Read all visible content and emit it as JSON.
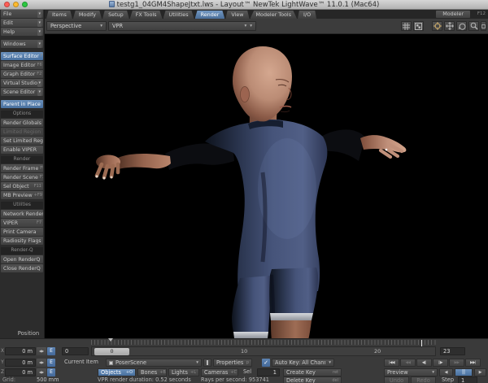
{
  "colors": {
    "accent_blue": "#4a6e99",
    "titlebar_close": "#ff5e57",
    "titlebar_minimize": "#febb2e",
    "titlebar_zoom": "#2bc840",
    "viewport_bg": "#000000",
    "panel_bg": "#3a3a3a",
    "suit_navy": "#46547a",
    "skin": "#b9856c"
  },
  "titlebar": {
    "title": "testg1_04GM4ShapeJtxt.lws - Layout™ NewTek LightWave™ 11.0.1 (Mac64)"
  },
  "icons": {
    "dropdown": "▾",
    "stepper": "◀▶",
    "checkmark": "✓"
  },
  "tabs": {
    "list": [
      {
        "label": "Items"
      },
      {
        "label": "Modify"
      },
      {
        "label": "Setup"
      },
      {
        "label": "FX Tools"
      },
      {
        "label": "Utilities"
      },
      {
        "label": "Render",
        "active": true
      },
      {
        "label": "View"
      },
      {
        "label": "Modeler Tools"
      },
      {
        "label": "I/O"
      }
    ],
    "modeler": {
      "label": "Modeler",
      "shortcut": "F12"
    }
  },
  "viewport": {
    "view_mode": "Perspective",
    "render_mode": "VPR",
    "content": "3d-human-figure-t-pose"
  },
  "sidebar": {
    "items": [
      {
        "label": "File",
        "type": "dropdown"
      },
      {
        "label": "Edit",
        "type": "dropdown"
      },
      {
        "label": "Help",
        "type": "dropdown"
      },
      {
        "label": "Windows",
        "type": "dropdown"
      },
      {
        "label": "Surface Editor",
        "shortcut": "F5",
        "active": true
      },
      {
        "label": "Image Editor",
        "shortcut": "F6"
      },
      {
        "label": "Graph Editor",
        "shortcut": "F2"
      },
      {
        "label": "Virtual Studio",
        "type": "dropdown"
      },
      {
        "label": "Scene Editor",
        "type": "dropdown"
      },
      {
        "label": "Parent in Place",
        "active": true
      },
      {
        "label": "Options",
        "type": "header"
      },
      {
        "label": "Render Globals",
        "shortcut": "F8"
      },
      {
        "label": "Limited Region",
        "disabled": true
      },
      {
        "label": "Set Limited Reg..."
      },
      {
        "label": "Enable VIPER"
      },
      {
        "label": "Render",
        "type": "header"
      },
      {
        "label": "Render Frame",
        "shortcut": "F9"
      },
      {
        "label": "Render Scene",
        "shortcut": "F10"
      },
      {
        "label": "Sel Object",
        "shortcut": "F11"
      },
      {
        "label": "MB Preview",
        "shortcut": "+F9"
      },
      {
        "label": "Utilities",
        "type": "header"
      },
      {
        "label": "Network Render"
      },
      {
        "label": "VIPER",
        "shortcut": "F7"
      },
      {
        "label": "Print Camera"
      },
      {
        "label": "Radiosity Flags"
      },
      {
        "label": "Render-Q",
        "type": "header"
      },
      {
        "label": "Open RenderQ"
      },
      {
        "label": "Close RenderQ"
      }
    ]
  },
  "position_panel": {
    "title": "Position",
    "axes": [
      {
        "axis": "X",
        "value": "0 m"
      },
      {
        "axis": "Y",
        "value": "0 m"
      },
      {
        "axis": "Z",
        "value": "0 m"
      }
    ],
    "envelope": "E",
    "grid_label": "Grid:",
    "grid_value": "500 mm"
  },
  "timeline": {
    "current_frame": "0",
    "handle": "0",
    "tick_10": "10",
    "tick_20": "20",
    "end_frame": "23"
  },
  "controls": {
    "current_item_label": "Current Item",
    "current_item_value": "PoserScene",
    "properties": "Properties",
    "properties_shortcut": "p",
    "autokey": "Auto Key: All Chann...",
    "types": [
      {
        "label": "Objects",
        "shortcut": "+O",
        "active": true
      },
      {
        "label": "Bones",
        "shortcut": "+B"
      },
      {
        "label": "Lights",
        "shortcut": "+L"
      },
      {
        "label": "Cameras",
        "shortcut": "+C"
      }
    ],
    "sel_label": "Sel",
    "sel_value": "1",
    "create_key": "Create Key",
    "create_key_shortcut": "ret",
    "delete_key": "Delete Key",
    "delete_key_shortcut": "del",
    "preview": "Preview",
    "undo": "Undo",
    "redo": "Redo",
    "step_label": "Step",
    "step_value": "1",
    "transport": [
      {
        "glyph": "|◀◀"
      },
      {
        "glyph": "◀◀",
        "disabled": true
      },
      {
        "glyph": "◀||"
      },
      {
        "glyph": "||▶"
      },
      {
        "glyph": "▶▶",
        "disabled": true
      },
      {
        "glyph": "▶▶|"
      }
    ],
    "play": [
      {
        "glyph": "◀"
      },
      {
        "glyph": "||",
        "active": true
      },
      {
        "glyph": "▶"
      }
    ]
  },
  "status": {
    "vpr_duration": "VPR render duration: 0.52 seconds",
    "rays": "Rays per second: 953741"
  }
}
